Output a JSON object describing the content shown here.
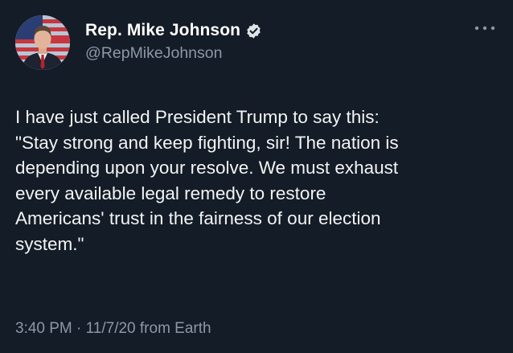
{
  "author": {
    "display_name": "Rep. Mike Johnson",
    "handle": "@RepMikeJohnson",
    "verified": true,
    "verified_color": "#1d9bf0"
  },
  "tweet": {
    "text": "I have just called President Trump to say this:\n\"Stay strong and keep fighting, sir! The nation is\ndepending upon your resolve. We must exhaust\nevery available legal remedy to restore\nAmericans' trust in the fairness of our election\nsystem.\"",
    "timestamp": "3:40 PM · 11/7/20 from Earth"
  },
  "icons": {
    "verified": "verified-badge-icon",
    "more": "more-options-icon"
  },
  "colors": {
    "background": "#141c27",
    "primary_text": "#ffffff",
    "secondary_text": "#8b98a5"
  }
}
